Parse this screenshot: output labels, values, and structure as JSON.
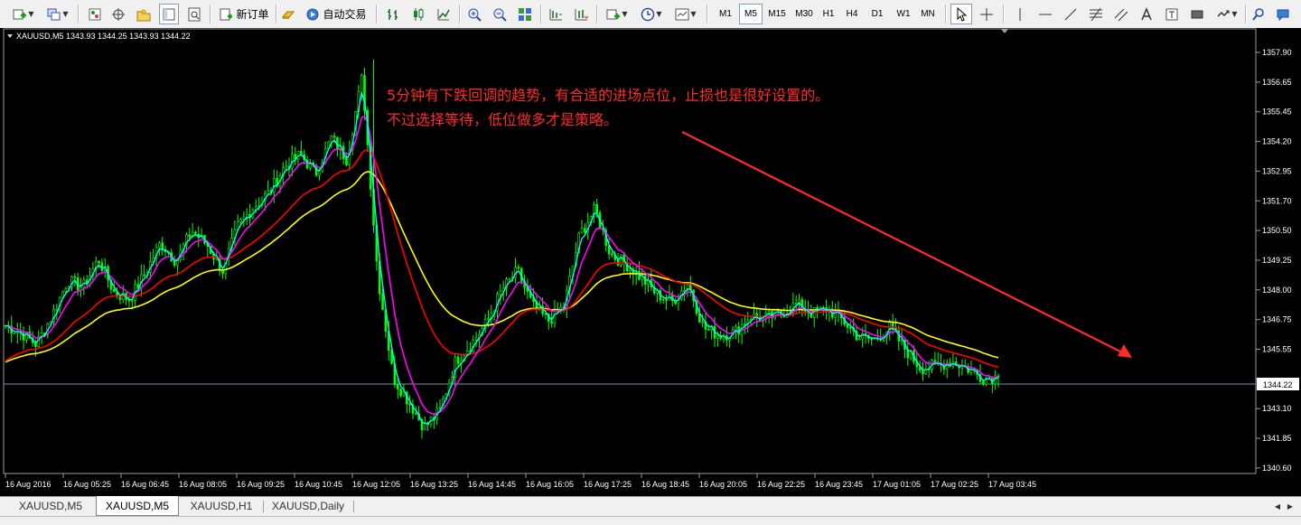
{
  "toolbar": {
    "new_order_label": "新订单",
    "autotrading_label": "自动交易",
    "timeframes": [
      "M1",
      "M5",
      "M15",
      "M30",
      "H1",
      "H4",
      "D1",
      "W1",
      "MN"
    ],
    "active_timeframe": "M5"
  },
  "chart_info": {
    "header": "XAUUSD,M5  1343.93 1344.25 1343.93 1344.22",
    "current_price_label": "1344.22"
  },
  "annotation": {
    "line1": "5分钟有下跌回调的趋势，有合适的进场点位，止损也是很好设置的。",
    "line2": "不过选择等待，低位做多才是策略。",
    "color": "#ff2a2a"
  },
  "tabs": [
    "XAUUSD,M5",
    "XAUUSD,M5",
    "XAUUSD,H1",
    "XAUUSD,Daily"
  ],
  "active_tab_index": 1,
  "colors": {
    "background": "#000000",
    "candles": "#00ff00",
    "ma_fast_cyan": "#00ffff",
    "ma_magenta": "#ff00ff",
    "ma_red": "#ff0000",
    "ma_yellow": "#ffff00",
    "arrow": "#ff2a2a",
    "grid_text": "#ffffff"
  },
  "chart_data": {
    "type": "line",
    "symbol": "XAUUSD",
    "timeframe": "M5",
    "ylim": [
      1340.0,
      1358.4
    ],
    "y_ticks": [
      "1357.90",
      "1356.65",
      "1355.45",
      "1354.20",
      "1352.95",
      "1351.70",
      "1350.50",
      "1349.25",
      "1348.00",
      "1346.75",
      "1345.55",
      "1344.30",
      "1343.10",
      "1341.85",
      "1340.60"
    ],
    "x_ticks": [
      "16 Aug 2016",
      "16 Aug 05:25",
      "16 Aug 06:45",
      "16 Aug 08:05",
      "16 Aug 09:25",
      "16 Aug 10:45",
      "16 Aug 12:05",
      "16 Aug 13:25",
      "16 Aug 14:45",
      "16 Aug 16:05",
      "16 Aug 17:25",
      "16 Aug 18:45",
      "16 Aug 20:05",
      "16 Aug 22:25",
      "16 Aug 23:45",
      "17 Aug 01:05",
      "17 Aug 02:25",
      "17 Aug 03:45"
    ],
    "last_price": 1344.22,
    "price_trace": [
      1346.4,
      1346.1,
      1345.6,
      1346.8,
      1348.3,
      1348.0,
      1349.2,
      1347.8,
      1347.5,
      1348.6,
      1349.9,
      1349.1,
      1350.4,
      1349.8,
      1348.7,
      1350.6,
      1351.4,
      1352.0,
      1353.1,
      1353.6,
      1352.8,
      1354.3,
      1353.4,
      1356.9,
      1348.5,
      1344.2,
      1343.2,
      1342.1,
      1342.8,
      1344.9,
      1345.6,
      1346.5,
      1347.9,
      1348.7,
      1347.2,
      1346.6,
      1347.2,
      1350.2,
      1351.3,
      1349.4,
      1349.0,
      1348.4,
      1347.7,
      1347.4,
      1348.2,
      1346.3,
      1346.0,
      1346.1,
      1346.8,
      1346.7,
      1346.9,
      1347.3,
      1346.9,
      1347.1,
      1346.6,
      1345.9,
      1345.8,
      1346.3,
      1345.4,
      1344.6,
      1344.7,
      1344.9,
      1344.6,
      1344.2,
      1344.22
    ],
    "series": []
  }
}
